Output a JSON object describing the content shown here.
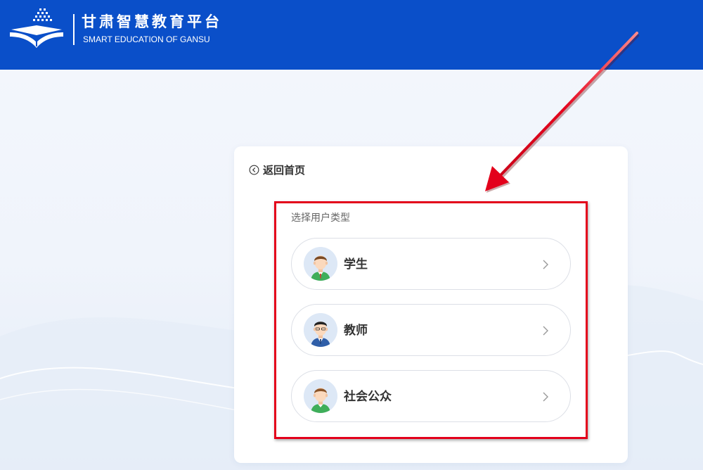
{
  "header": {
    "title": "甘肃智慧教育平台",
    "subtitle": "SMART EDUCATION OF GANSU",
    "logo_icon": "open-book-logo-icon"
  },
  "back": {
    "label": "返回首页",
    "icon": "circle-chevron-left-icon"
  },
  "select": {
    "title": "选择用户类型"
  },
  "roles": [
    {
      "label": "学生",
      "icon": "student-avatar-icon",
      "chevron": "chevron-right-icon"
    },
    {
      "label": "教师",
      "icon": "teacher-avatar-icon",
      "chevron": "chevron-right-icon"
    },
    {
      "label": "社会公众",
      "icon": "public-avatar-icon",
      "chevron": "chevron-right-icon"
    }
  ],
  "annotation": {
    "box_color": "#e3001b",
    "arrow_color": "#e3001b"
  },
  "colors": {
    "header_bg": "#0a4fc9",
    "page_bg": "#f4f7fd",
    "card_bg": "#ffffff",
    "text_primary": "#333333",
    "text_secondary": "#666666"
  }
}
